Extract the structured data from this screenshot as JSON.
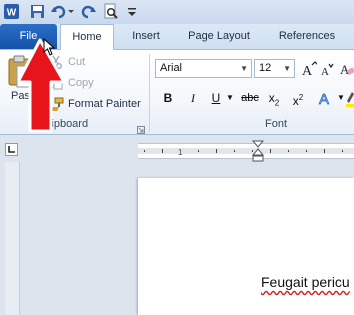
{
  "colors": {
    "accent": "#1a5bb5",
    "arrow": "#e8141b",
    "ribbon_bg": "#f4f7fb"
  },
  "quick_access": {
    "icons": [
      "word-logo-icon",
      "save-icon",
      "undo-icon",
      "redo-icon",
      "print-preview-icon",
      "customize-qat-icon"
    ]
  },
  "tabs": [
    {
      "label": "File"
    },
    {
      "label": "Home"
    },
    {
      "label": "Insert"
    },
    {
      "label": "Page Layout"
    },
    {
      "label": "References"
    }
  ],
  "clipboard": {
    "paste_label": "Paste",
    "cut_label": "Cut",
    "copy_label": "Copy",
    "format_painter_label": "Format Painter",
    "group_label": "Clipboard"
  },
  "font": {
    "font_name": "Arial",
    "font_size": "12",
    "group_label": "Font"
  },
  "document": {
    "text": "Feugait pericu"
  }
}
